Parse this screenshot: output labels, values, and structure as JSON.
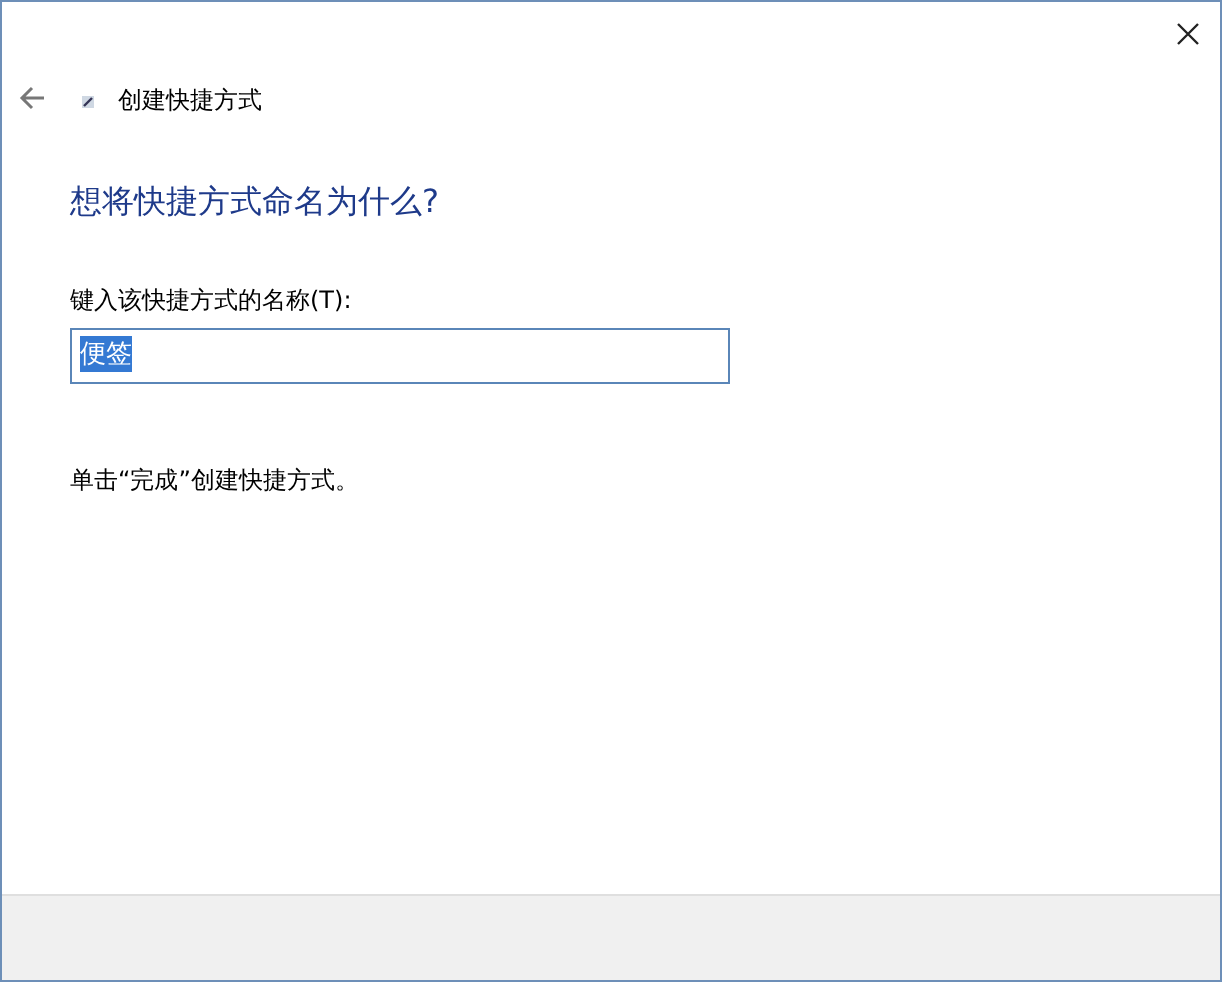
{
  "window": {
    "title": "创建快捷方式"
  },
  "heading": "想将快捷方式命名为什么?",
  "name_field": {
    "label": "键入该快捷方式的名称(T):",
    "value": "便签",
    "text_selected": true
  },
  "instruction": "单击“完成”创建快捷方式。"
}
